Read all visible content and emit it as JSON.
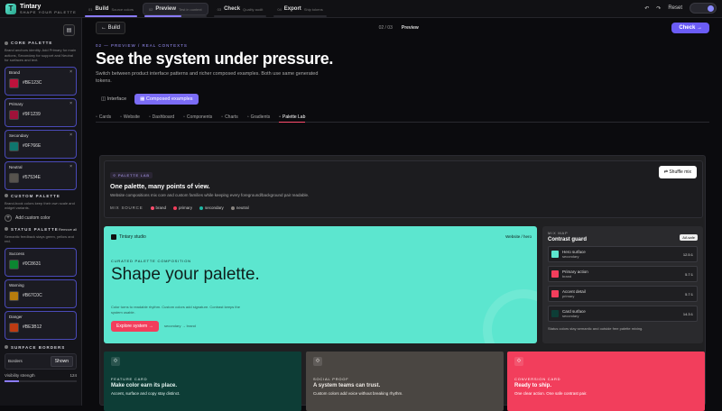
{
  "app": {
    "name": "Tintary",
    "tagline": "SHAPE YOUR PALETTE"
  },
  "steps": [
    {
      "num": "01",
      "label": "Build",
      "sub": "Source colors",
      "progress": 1.0
    },
    {
      "num": "02",
      "label": "Preview",
      "sub": "Test in context",
      "progress": 0.6
    },
    {
      "num": "03",
      "label": "Check",
      "sub": "Quality audit",
      "progress": 0.0
    },
    {
      "num": "04",
      "label": "Export",
      "sub": "Ship tokens",
      "progress": 0.0
    }
  ],
  "topright": {
    "undo": "↶",
    "redo": "↷",
    "reset": "Reset",
    "avatar": "⟐"
  },
  "sidebar": {
    "core_title": "CORE PALETTE",
    "core_desc": "Brand anchors identity. Add Primary for main actions, Secondary for support and Neutral for surfaces and text.",
    "core": [
      {
        "name": "Brand",
        "hex": "#BE123C",
        "color": "#BE123C"
      },
      {
        "name": "Primary",
        "hex": "#9F1239",
        "color": "#9F1239"
      },
      {
        "name": "Secondary",
        "hex": "#0F766E",
        "color": "#0F766E"
      },
      {
        "name": "Neutral",
        "hex": "#57534E",
        "color": "#57534E"
      }
    ],
    "custom_title": "CUSTOM PALETTE",
    "custom_desc": "Brand-book colors keep their own scale and widget variants.",
    "add_custom": "Add custom color",
    "status_title": "STATUS PALETTE",
    "remove_all": "Remove all",
    "status_desc": "Semantic feedback stays green, yellow and red.",
    "status": [
      {
        "name": "Success",
        "hex": "#0C8631",
        "color": "#0C8631"
      },
      {
        "name": "Warning",
        "hex": "#B67C0C",
        "color": "#B67C0C"
      },
      {
        "name": "Danger",
        "hex": "#BE3B12",
        "color": "#BE3B12"
      }
    ],
    "surface_title": "SURFACE BORDERS",
    "borders_label": "Borders",
    "borders_value": "Shown",
    "visibility_label": "Visibility strength",
    "visibility_value": "124",
    "visibility_fraction": 0.2
  },
  "main": {
    "back": "Build",
    "pager_left": "02 / 03",
    "pager_right": "Preview",
    "check": "Check",
    "eyebrow": "02 — PREVIEW / REAL CONTEXTS",
    "title": "See the system under pressure.",
    "lead": "Switch between product interface patterns and richer composed examples. Both use same generated tokens.",
    "seg": [
      "Interface",
      "Composed examples"
    ],
    "tabs": [
      "Cards",
      "Website",
      "Dashboard",
      "Components",
      "Charts",
      "Gradients",
      "Palette Lab"
    ],
    "lab": {
      "pill": "PALETTE LAB",
      "title": "One palette, many points of view.",
      "desc": "Website compositions mix core and custom families while keeping every foreground/background pair readable.",
      "shuffle": "Shuffle mix",
      "mix_label": "MIX SOURCE",
      "mix": [
        {
          "name": "brand",
          "color": "#ff4d6d"
        },
        {
          "name": "primary",
          "color": "#f23e5c"
        },
        {
          "name": "secondary",
          "color": "#1fb7a4"
        },
        {
          "name": "neutral",
          "color": "#8a8580"
        }
      ]
    },
    "hero": {
      "brand": "Tintary studio",
      "tag": "Website / hero",
      "eyebrow": "CURATED PALETTE COMPOSITION",
      "title": "Shape your palette.",
      "text": "Color turns to readable rhythm. Custom colors add signature. Contrast keeps the system usable.",
      "cta": "Explore system →",
      "sub": "secondary → brand"
    },
    "mixmap": {
      "label": "MIX MAP",
      "title": "Contrast guard",
      "badge": "AA safe",
      "rows": [
        {
          "name": "Hero surface",
          "role": "secondary",
          "ratio": "12.5:1",
          "color": "#5ce6cf"
        },
        {
          "name": "Primary action",
          "role": "brand",
          "ratio": "5.7:1",
          "color": "#f23e5c"
        },
        {
          "name": "Accent detail",
          "role": "primary",
          "ratio": "5.7:1",
          "color": "#f23e5c"
        },
        {
          "name": "Card surface",
          "role": "secondary",
          "ratio": "14.3:1",
          "color": "#0d3d36"
        }
      ],
      "foot": "Status colors stay semantic and outside free palette mixing."
    },
    "cards": [
      {
        "eyebrow": "FEATURE CARD",
        "title": "Make color earn its place.",
        "text": "Accent, surface and copy stay distinct.",
        "bg": "#0d3d36",
        "fg": "#e6f5f2",
        "icon": "⟐"
      },
      {
        "eyebrow": "SOCIAL PROOF",
        "title": "A system teams can trust.",
        "text": "Custom colors add voice without breaking rhythm.",
        "bg": "#4a4642",
        "fg": "#f0ebe6",
        "icon": "⟐"
      },
      {
        "eyebrow": "CONVERSION CARD",
        "title": "Ready to ship.",
        "text": "One clear action. One safe contrast pair.",
        "bg": "#f23e5c",
        "fg": "#ffffff",
        "icon": "⟐"
      }
    ]
  }
}
